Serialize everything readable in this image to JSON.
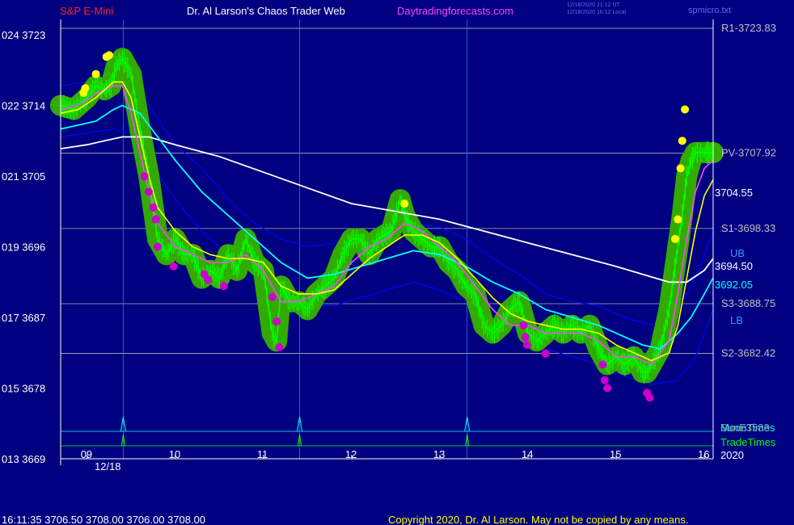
{
  "header": {
    "symbol": "S&P E-Mini",
    "site_title": "Dr. Al Larson's Chaos Trader Web",
    "url": "Daytradingforecasts.com",
    "time_line1": "12/18/2020 21:12 UT",
    "time_line2": "12/18/2020 16:12 Local",
    "file_name": "spmicro.txt"
  },
  "footer": {
    "quote": "16:11:35  3706.50 3708.00 3706.00 3708.00",
    "copyright": "Copyright 2020, Dr. Al Larson. May not be copied by any means."
  },
  "colors": {
    "background": "#000080",
    "price": "#00ff00",
    "halo": "#33aa00",
    "ema_fast": "#ffff00",
    "ema_mid": "#ff44ff",
    "ema_slow": "#00ffff",
    "ema_long": "#ffffff",
    "bands": "#0000ff",
    "dot_high": "#ffff00",
    "dot_low": "#cc00cc",
    "level": "#b0b0b0",
    "label_level": "#c0c0c0",
    "label_blue": "#3399ff"
  },
  "chart_data": {
    "type": "line",
    "title": "S&P E-Mini",
    "date_label": "12/18",
    "year_label": "2020",
    "xlim": [
      8.7,
      16.1
    ],
    "ylim": [
      3669,
      3727.5
    ],
    "x_ticks": [
      "09",
      "10",
      "11",
      "12",
      "13",
      "14",
      "15",
      "16"
    ],
    "y_ticks": [
      {
        "price": 3669,
        "label": "013  3669"
      },
      {
        "price": 3678,
        "label": "015  3678"
      },
      {
        "price": 3687,
        "label": "017  3687"
      },
      {
        "price": 3696,
        "label": "019  3696"
      },
      {
        "price": 3705,
        "label": "021  3705"
      },
      {
        "price": 3714,
        "label": "022  3714"
      },
      {
        "price": 3723,
        "label": "024  3723"
      }
    ],
    "levels": [
      {
        "name": "R1",
        "value": 3723.83,
        "label": "R1-3723.83"
      },
      {
        "name": "PV",
        "value": 3707.92,
        "label": "PV-3707.92"
      },
      {
        "name": "S1",
        "value": 3698.33,
        "label": "S1-3698.33"
      },
      {
        "name": "S3",
        "value": 3688.75,
        "label": "S3-3688.75"
      },
      {
        "name": "S2",
        "value": 3682.42,
        "label": "S2-3682.42"
      }
    ],
    "band_labels": {
      "upper": "UB",
      "lower": "LB"
    },
    "price_labels": [
      {
        "series": "ema_fast",
        "value": 3704.55,
        "label": "3704.55"
      },
      {
        "series": "ema_long",
        "value": 3694.5,
        "label": "3694.50"
      },
      {
        "series": "ema_slow",
        "value": 3692.05,
        "label": "3692.05"
      }
    ],
    "sub_labels": {
      "moon": "MoonTimes",
      "trade": "TradeTimes",
      "extra": "SunE3583"
    },
    "spike_times": [
      9.41,
      11.41,
      13.31
    ],
    "series": [
      {
        "key": "price",
        "x": [
          8.7,
          8.85,
          9.0,
          9.1,
          9.2,
          9.27,
          9.33,
          9.4,
          9.5,
          9.6,
          9.7,
          9.75,
          9.8,
          9.9,
          10.0,
          10.1,
          10.2,
          10.3,
          10.4,
          10.5,
          10.6,
          10.7,
          10.8,
          10.9,
          11.0,
          11.1,
          11.15,
          11.2,
          11.3,
          11.4,
          11.5,
          11.6,
          11.7,
          11.8,
          11.9,
          12.0,
          12.1,
          12.2,
          12.3,
          12.45,
          12.55,
          12.6,
          12.65,
          12.7,
          12.8,
          12.9,
          13.0,
          13.1,
          13.2,
          13.3,
          13.4,
          13.5,
          13.6,
          13.7,
          13.8,
          13.9,
          14.0,
          14.1,
          14.2,
          14.3,
          14.4,
          14.5,
          14.6,
          14.7,
          14.8,
          14.85,
          14.9,
          15.0,
          15.1,
          15.2,
          15.3,
          15.35,
          15.4,
          15.5,
          15.6,
          15.65,
          15.7,
          15.75,
          15.8,
          15.85,
          15.9,
          16.0,
          16.05,
          16.1
        ],
        "y": [
          3714,
          3713.5,
          3715,
          3716.5,
          3716,
          3716.5,
          3719,
          3720,
          3718,
          3711,
          3705,
          3701,
          3697,
          3695,
          3697,
          3695,
          3695,
          3692,
          3693,
          3692,
          3695,
          3693,
          3697,
          3694,
          3693,
          3685,
          3684,
          3691,
          3689,
          3689,
          3688,
          3690,
          3691,
          3692,
          3695,
          3697,
          3697,
          3695,
          3697,
          3698,
          3702,
          3700,
          3699,
          3698,
          3697,
          3696,
          3696,
          3694,
          3693,
          3691,
          3690,
          3686,
          3685,
          3686,
          3688,
          3689,
          3685,
          3684,
          3685,
          3686,
          3685,
          3686,
          3685,
          3686,
          3683,
          3682,
          3681,
          3682,
          3681,
          3682,
          3680,
          3680,
          3681,
          3683,
          3688,
          3692,
          3696,
          3700,
          3705,
          3707,
          3708,
          3708,
          3708,
          3708
        ]
      },
      {
        "key": "ema_mid",
        "x": [
          8.7,
          8.9,
          9.1,
          9.3,
          9.4,
          9.5,
          9.6,
          9.7,
          9.8,
          10.0,
          10.2,
          10.4,
          10.6,
          10.8,
          11.0,
          11.2,
          11.4,
          11.6,
          11.8,
          12.0,
          12.2,
          12.4,
          12.6,
          12.8,
          13.0,
          13.2,
          13.4,
          13.6,
          13.8,
          14.0,
          14.2,
          14.4,
          14.6,
          14.8,
          15.0,
          15.2,
          15.4,
          15.6,
          15.7,
          15.8,
          15.9,
          16.0,
          16.1
        ],
        "y": [
          3713.5,
          3714,
          3715.5,
          3716.5,
          3716.5,
          3713,
          3708,
          3703,
          3699,
          3696,
          3695,
          3694,
          3694,
          3695,
          3693,
          3689,
          3689,
          3690,
          3691,
          3694,
          3696,
          3697,
          3699,
          3698,
          3696,
          3694,
          3691,
          3688,
          3686,
          3686,
          3685,
          3685,
          3685,
          3684,
          3682,
          3682,
          3681,
          3684,
          3690,
          3697,
          3703,
          3706,
          3707
        ]
      },
      {
        "key": "ema_fast",
        "x": [
          8.7,
          8.9,
          9.1,
          9.3,
          9.4,
          9.5,
          9.6,
          9.7,
          9.8,
          10.0,
          10.2,
          10.4,
          10.6,
          10.8,
          11.0,
          11.2,
          11.4,
          11.6,
          11.8,
          12.0,
          12.2,
          12.4,
          12.6,
          12.8,
          13.0,
          13.2,
          13.4,
          13.6,
          13.8,
          14.0,
          14.2,
          14.4,
          14.6,
          14.8,
          15.0,
          15.2,
          15.4,
          15.6,
          15.7,
          15.8,
          15.9,
          16.0,
          16.1
        ],
        "y": [
          3713,
          3713.5,
          3715,
          3717,
          3717,
          3715,
          3710,
          3705,
          3701,
          3698,
          3696,
          3695,
          3694.5,
          3694.5,
          3694,
          3691,
          3690,
          3690,
          3690.5,
          3692.5,
          3694.5,
          3696,
          3697.5,
          3697.5,
          3696.5,
          3694.5,
          3692,
          3689.5,
          3687.5,
          3686.5,
          3686,
          3685.5,
          3685.5,
          3685,
          3683.5,
          3682.5,
          3681.5,
          3682.5,
          3686,
          3692,
          3698,
          3702.5,
          3704.55
        ]
      },
      {
        "key": "ema_slow",
        "x": [
          8.7,
          8.9,
          9.1,
          9.3,
          9.4,
          9.6,
          9.8,
          10.0,
          10.3,
          10.6,
          10.9,
          11.2,
          11.5,
          11.8,
          12.1,
          12.4,
          12.7,
          13.0,
          13.3,
          13.6,
          13.9,
          14.2,
          14.5,
          14.8,
          15.1,
          15.3,
          15.5,
          15.7,
          15.85,
          16.0,
          16.1
        ],
        "y": [
          3711,
          3711.5,
          3712,
          3713.5,
          3714,
          3713,
          3710,
          3707,
          3703,
          3700,
          3697,
          3694,
          3692,
          3692.5,
          3693.5,
          3694.5,
          3695.5,
          3695,
          3693.5,
          3691.5,
          3690,
          3688,
          3687,
          3686,
          3684.5,
          3683.5,
          3683,
          3685,
          3687,
          3690,
          3692.05
        ]
      },
      {
        "key": "ema_long",
        "x": [
          8.7,
          9.0,
          9.2,
          9.4,
          9.7,
          10.0,
          10.5,
          11.0,
          11.5,
          12.0,
          12.5,
          13.0,
          13.5,
          14.0,
          14.5,
          15.0,
          15.3,
          15.6,
          15.8,
          16.0,
          16.1
        ],
        "y": [
          3708.5,
          3709,
          3709.5,
          3710,
          3710,
          3709,
          3707.5,
          3705.5,
          3703.5,
          3701.5,
          3700.5,
          3699.5,
          3698,
          3696.5,
          3695,
          3693.5,
          3692.5,
          3691.5,
          3691.5,
          3693,
          3694.5
        ]
      },
      {
        "key": "band_upper",
        "x": [
          8.7,
          9.0,
          9.3,
          9.5,
          9.7,
          10.0,
          10.3,
          10.6,
          10.9,
          11.2,
          11.5,
          11.8,
          12.1,
          12.4,
          12.7,
          13.0,
          13.3,
          13.6,
          13.9,
          14.2,
          14.5,
          14.8,
          15.1,
          15.4,
          15.7,
          15.9,
          16.1
        ],
        "y": [
          3716.5,
          3717,
          3717.5,
          3717,
          3714,
          3709,
          3706,
          3702,
          3699,
          3697,
          3696,
          3696.5,
          3697.5,
          3698.5,
          3699,
          3698.5,
          3697,
          3694.5,
          3692.5,
          3690,
          3689,
          3688.5,
          3687,
          3686,
          3688,
          3692,
          3698
        ]
      },
      {
        "key": "band_lower",
        "x": [
          8.7,
          9.0,
          9.3,
          9.5,
          9.7,
          10.0,
          10.3,
          10.6,
          10.9,
          11.2,
          11.5,
          11.8,
          12.1,
          12.4,
          12.7,
          13.0,
          13.3,
          13.6,
          13.9,
          14.2,
          14.5,
          14.8,
          15.1,
          15.4,
          15.7,
          15.9,
          16.1
        ],
        "y": [
          3710,
          3710.5,
          3711,
          3710.5,
          3707,
          3702,
          3698,
          3695,
          3692.5,
          3690,
          3688.5,
          3688.5,
          3689.5,
          3690.5,
          3691.5,
          3690.5,
          3689,
          3687,
          3685,
          3683,
          3682,
          3681,
          3679.5,
          3678.5,
          3679,
          3682,
          3688
        ]
      }
    ],
    "dots_high": [
      {
        "x": 9.22,
        "y": 3720.2
      },
      {
        "x": 9.25,
        "y": 3720.4
      },
      {
        "x": 8.98,
        "y": 3716.2
      },
      {
        "x": 8.96,
        "y": 3715.6
      },
      {
        "x": 9.1,
        "y": 3718.0
      },
      {
        "x": 12.6,
        "y": 3701.5
      },
      {
        "x": 15.67,
        "y": 3697
      },
      {
        "x": 15.7,
        "y": 3699.5
      },
      {
        "x": 15.73,
        "y": 3706
      },
      {
        "x": 15.75,
        "y": 3709.5
      },
      {
        "x": 15.78,
        "y": 3713.5
      }
    ],
    "dots_low": [
      {
        "x": 9.65,
        "y": 3705
      },
      {
        "x": 9.7,
        "y": 3703
      },
      {
        "x": 9.75,
        "y": 3701
      },
      {
        "x": 9.78,
        "y": 3699.5
      },
      {
        "x": 9.8,
        "y": 3696
      },
      {
        "x": 9.98,
        "y": 3693.5
      },
      {
        "x": 10.33,
        "y": 3692.5
      },
      {
        "x": 10.37,
        "y": 3691.8
      },
      {
        "x": 10.55,
        "y": 3691
      },
      {
        "x": 11.1,
        "y": 3689.6
      },
      {
        "x": 11.15,
        "y": 3686.5
      },
      {
        "x": 11.18,
        "y": 3683.2
      },
      {
        "x": 13.95,
        "y": 3686
      },
      {
        "x": 13.97,
        "y": 3684.5
      },
      {
        "x": 13.99,
        "y": 3683.5
      },
      {
        "x": 14.2,
        "y": 3682.4
      },
      {
        "x": 14.85,
        "y": 3681
      },
      {
        "x": 14.87,
        "y": 3679
      },
      {
        "x": 14.9,
        "y": 3678
      },
      {
        "x": 15.35,
        "y": 3677.4
      },
      {
        "x": 15.38,
        "y": 3676.8
      }
    ]
  }
}
